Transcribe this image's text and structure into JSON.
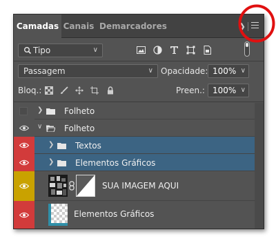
{
  "tabs": [
    {
      "label": "Camadas",
      "active": true
    },
    {
      "label": "Canais",
      "active": false
    },
    {
      "label": "Demarcadores",
      "active": false
    }
  ],
  "filter": {
    "label": "Tipo",
    "icons": [
      "image-filter-icon",
      "adjustment-filter-icon",
      "type-filter-icon",
      "shape-filter-icon",
      "smart-object-filter-icon"
    ]
  },
  "blend": {
    "mode": "Passagem",
    "opacity_label": "Opacidade:",
    "opacity_value": "100%",
    "lock_label": "Bloq.:",
    "fill_label": "Preen.:",
    "fill_value": "100%"
  },
  "layers": [
    {
      "name": "Folheto",
      "type": "group",
      "expanded": false,
      "visible": false,
      "selected": false,
      "eye_color": "#535353",
      "indent": 0
    },
    {
      "name": "Folheto",
      "type": "group",
      "expanded": true,
      "visible": true,
      "selected": false,
      "eye_color": "#535353",
      "indent": 0
    },
    {
      "name": "Textos",
      "type": "group",
      "expanded": false,
      "visible": true,
      "selected": true,
      "eye_color": "#d23b3b",
      "indent": 1
    },
    {
      "name": "Elementos Gráficos",
      "type": "group",
      "expanded": false,
      "visible": true,
      "selected": true,
      "eye_color": "#d23b3b",
      "indent": 1
    },
    {
      "name": "SUA IMAGEM AQUI",
      "type": "masked-image",
      "visible": true,
      "selected": false,
      "eye_color": "#c9a200",
      "indent": 1
    },
    {
      "name": "Elementos Gráficos",
      "type": "smart-object",
      "visible": true,
      "selected": false,
      "eye_color": "#d23b3b",
      "indent": 1
    }
  ],
  "colors": {
    "panel_bg": "#535353",
    "selected_row": "#3c6483",
    "eye_red": "#d23b3b",
    "eye_yellow": "#c9a200",
    "highlight_circle": "#e01010"
  }
}
